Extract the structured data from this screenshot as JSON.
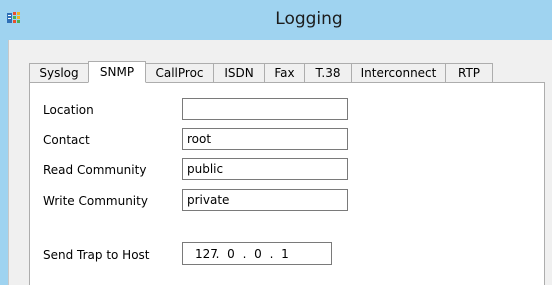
{
  "window": {
    "title": "Logging",
    "icon": "app-logging-icon"
  },
  "tabs": [
    {
      "label": "Syslog",
      "active": false
    },
    {
      "label": "SNMP",
      "active": true
    },
    {
      "label": "CallProc",
      "active": false
    },
    {
      "label": "ISDN",
      "active": false
    },
    {
      "label": "Fax",
      "active": false
    },
    {
      "label": "T.38",
      "active": false
    },
    {
      "label": "Interconnect",
      "active": false
    },
    {
      "label": "RTP",
      "active": false
    }
  ],
  "snmp": {
    "location": {
      "label": "Location",
      "value": ""
    },
    "contact": {
      "label": "Contact",
      "value": "root"
    },
    "read_community": {
      "label": "Read Community",
      "value": "public"
    },
    "write_community": {
      "label": "Write Community",
      "value": "private"
    },
    "trap_host": {
      "label": "Send Trap to Host",
      "octets": [
        "127",
        "0",
        "0",
        "1"
      ],
      "separator": "."
    }
  }
}
